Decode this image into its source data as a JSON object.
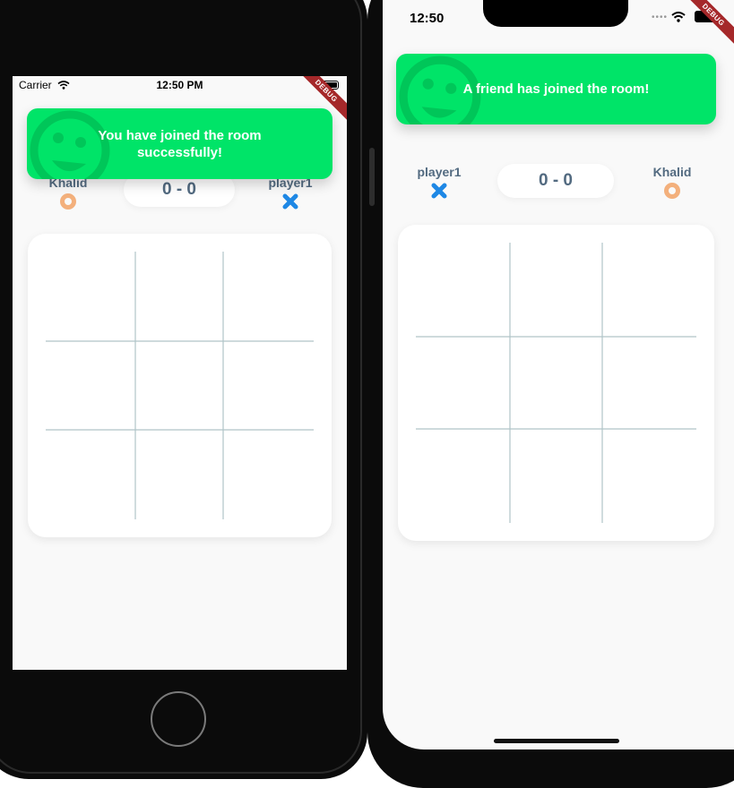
{
  "left_device": {
    "status_bar": {
      "carrier": "Carrier",
      "time": "12:50 PM"
    },
    "debug_ribbon": "DEBUG",
    "toast": {
      "message": "You have joined the room successfully!"
    },
    "players": [
      {
        "name": "Khalid",
        "mark": "o-icon"
      },
      {
        "name": "player1",
        "mark": "x-icon"
      }
    ],
    "score": "0 - 0",
    "board": {
      "rows": 3,
      "cols": 3
    }
  },
  "right_device": {
    "status_bar": {
      "time": "12:50"
    },
    "debug_ribbon": "DEBUG",
    "toast": {
      "message": "A friend has joined the room!"
    },
    "players": [
      {
        "name": "player1",
        "mark": "x-icon"
      },
      {
        "name": "Khalid",
        "mark": "o-icon"
      }
    ],
    "score": "0 - 0",
    "board": {
      "rows": 3,
      "cols": 3
    }
  },
  "colors": {
    "toast": "#00e468",
    "text_slate": "#526a80",
    "x_mark": "#1e88e5",
    "o_mark": "#f3b07c",
    "grid_line": "#b0c4c8",
    "debug": "#a5282a"
  }
}
